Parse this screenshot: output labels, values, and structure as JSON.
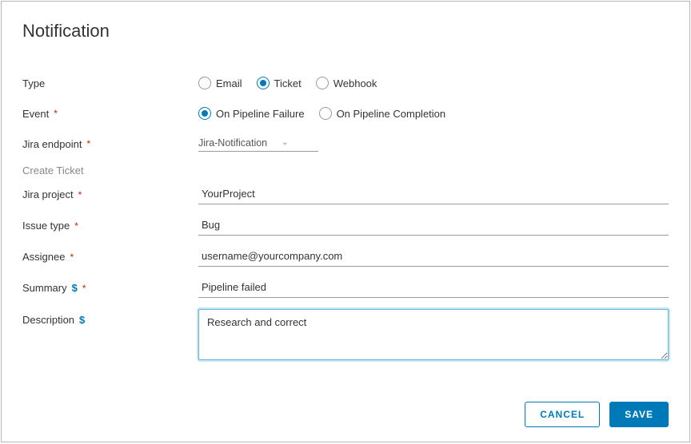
{
  "title": "Notification",
  "labels": {
    "type": "Type",
    "event": "Event",
    "jira_endpoint": "Jira endpoint",
    "create_ticket": "Create Ticket",
    "jira_project": "Jira project",
    "issue_type": "Issue type",
    "assignee": "Assignee",
    "summary": "Summary",
    "description": "Description"
  },
  "type_options": {
    "email": "Email",
    "ticket": "Ticket",
    "webhook": "Webhook",
    "selected": "ticket"
  },
  "event_options": {
    "failure": "On Pipeline Failure",
    "completion": "On Pipeline Completion",
    "selected": "failure"
  },
  "jira_endpoint": {
    "value": "Jira-Notification"
  },
  "jira_project": {
    "value": "YourProject"
  },
  "issue_type": {
    "value": "Bug"
  },
  "assignee": {
    "value": "username@yourcompany.com"
  },
  "summary": {
    "value": "Pipeline failed"
  },
  "description": {
    "value": "Research and correct"
  },
  "buttons": {
    "cancel": "Cancel",
    "save": "Save"
  },
  "symbols": {
    "required": "*",
    "variable": "$"
  }
}
